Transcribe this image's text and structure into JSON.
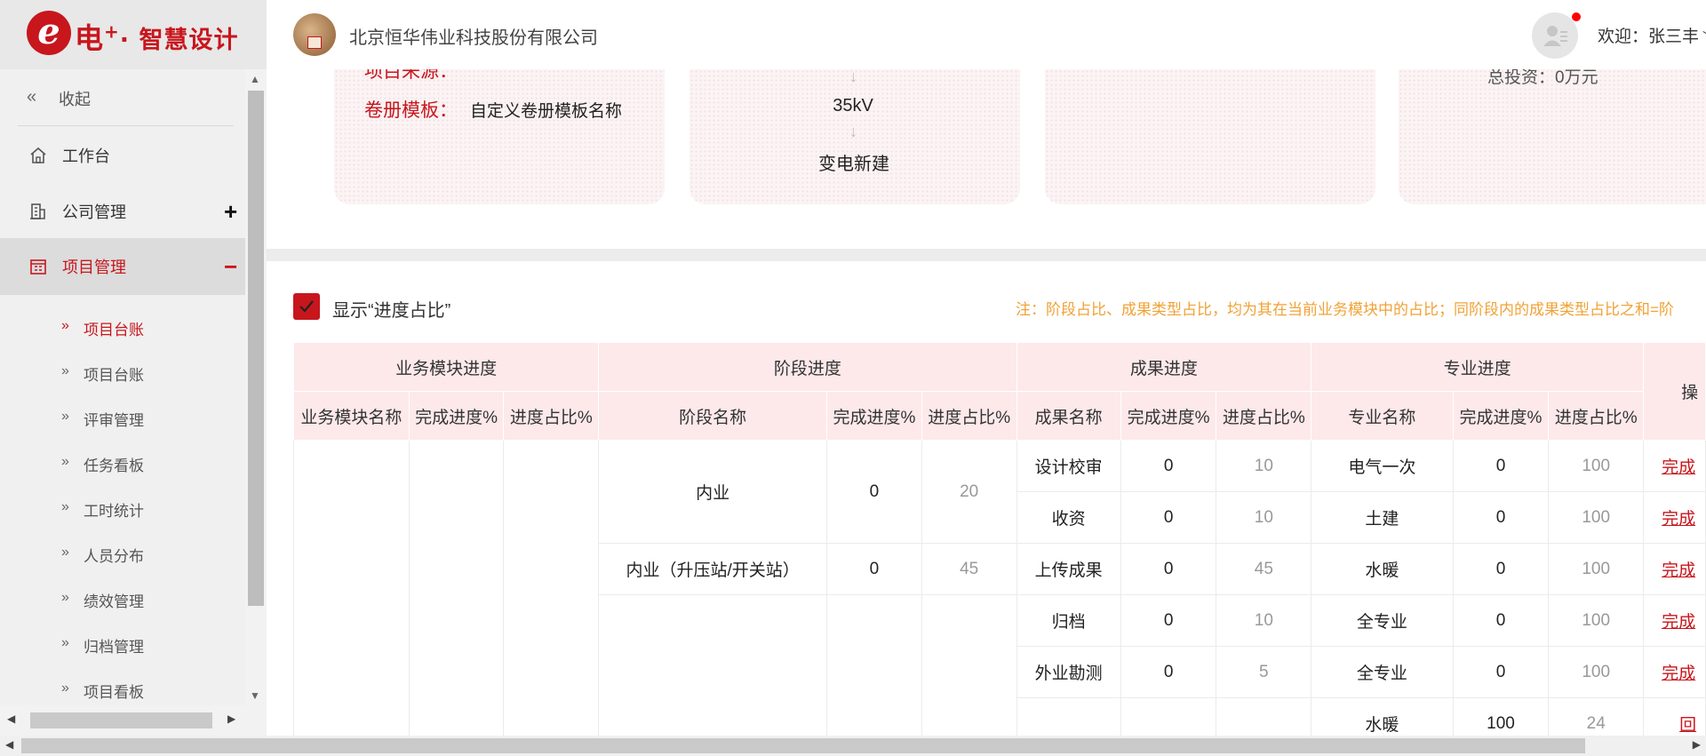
{
  "brand": {
    "logo_text": "电",
    "logo_sup": "+",
    "logo_suffix": "· 智慧设计"
  },
  "header": {
    "company": "北京恒华伟业科技股份有限公司",
    "welcome": "欢迎：张三丰",
    "notification_color": "#ff0000"
  },
  "sidebar": {
    "collapse_label": "收起",
    "items": [
      {
        "label": "工作台",
        "icon": "home-icon"
      },
      {
        "label": "公司管理",
        "icon": "building-icon",
        "sign": "+"
      },
      {
        "label": "项目管理",
        "icon": "calendar-icon",
        "sign": "−",
        "active": true
      }
    ],
    "sub_items": [
      {
        "label": "项目台账",
        "active": true
      },
      {
        "label": "项目台账"
      },
      {
        "label": "评审管理"
      },
      {
        "label": "任务看板"
      },
      {
        "label": "工时统计"
      },
      {
        "label": "人员分布"
      },
      {
        "label": "绩效管理"
      },
      {
        "label": "归档管理"
      },
      {
        "label": "项目看板"
      }
    ]
  },
  "info": {
    "source_label": "项目来源：",
    "source_value": "--",
    "template_label": "卷册模板：",
    "template_value": "自定义卷册模板名称",
    "voltage": "35kV",
    "build_type": "变电新建",
    "investment": "总投资：0万元"
  },
  "progress": {
    "show_ratio_label": "显示“进度占比”",
    "show_ratio_checked": true,
    "note": "注：阶段占比、成果类型占比，均为其在当前业务模块中的占比；同阶段内的成果类型占比之和=阶",
    "group_headers": [
      "业务模块进度",
      "阶段进度",
      "成果进度",
      "专业进度",
      "操"
    ],
    "sub_headers": {
      "module": [
        "业务模块名称",
        "完成进度%",
        "进度占比%"
      ],
      "stage": [
        "阶段名称",
        "完成进度%",
        "进度占比%"
      ],
      "result": [
        "成果名称",
        "完成进度%",
        "进度占比%"
      ],
      "discipline": [
        "专业名称",
        "完成进度%",
        "进度占比%"
      ]
    },
    "stages": [
      {
        "name": "内业",
        "done": "0",
        "ratio": "20"
      },
      {
        "name": "内业（升压站/开关站）",
        "done": "0",
        "ratio": "45"
      }
    ],
    "rows": [
      {
        "result": "设计校审",
        "r_done": "0",
        "r_ratio": "10",
        "disc": "电气一次",
        "d_done": "0",
        "d_ratio": "100",
        "op": "完成"
      },
      {
        "result": "收资",
        "r_done": "0",
        "r_ratio": "10",
        "disc": "土建",
        "d_done": "0",
        "d_ratio": "100",
        "op": "完成"
      },
      {
        "result": "上传成果",
        "r_done": "0",
        "r_ratio": "45",
        "disc": "水暖",
        "d_done": "0",
        "d_ratio": "100",
        "op": "完成"
      },
      {
        "result": "归档",
        "r_done": "0",
        "r_ratio": "10",
        "disc": "全专业",
        "d_done": "0",
        "d_ratio": "100",
        "op": "完成"
      },
      {
        "result": "外业勘测",
        "r_done": "0",
        "r_ratio": "5",
        "disc": "全专业",
        "d_done": "0",
        "d_ratio": "100",
        "op": "完成"
      },
      {
        "result": "",
        "r_done": "",
        "r_ratio": "",
        "disc": "水暖",
        "d_done": "100",
        "d_ratio": "24",
        "op": "回"
      }
    ]
  },
  "colors": {
    "brand_red": "#c8161d",
    "note_orange": "#f0a236",
    "header_pink": "#fde9ea"
  }
}
